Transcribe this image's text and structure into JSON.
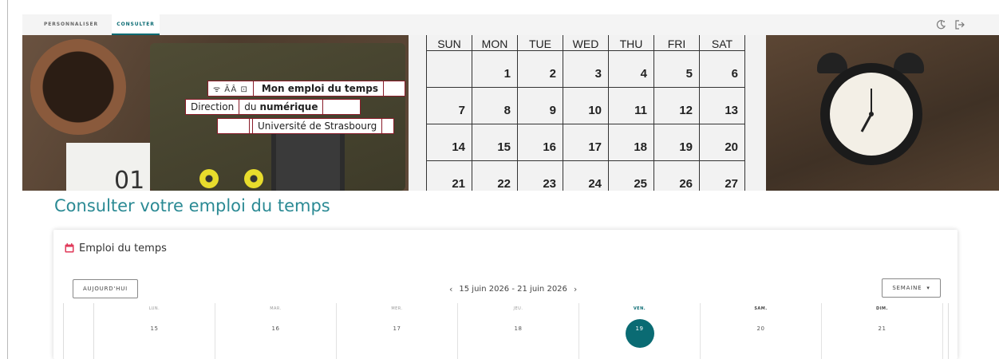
{
  "nav": {
    "tabs": [
      {
        "label": "PERSONNALISER",
        "active": false
      },
      {
        "label": "CONSULTER",
        "active": true
      }
    ],
    "icons": {
      "theme": "moon-sun-toggle-icon",
      "logout": "logout-icon"
    }
  },
  "banner": {
    "logo": {
      "symbols": "ᯤ ĂÂ ⊡",
      "line1": "Mon emploi du temps",
      "line2_prefix": "Direction",
      "line2_du": "du",
      "line2_bold": "numérique",
      "line3": "Université de Strasbourg"
    },
    "calendar_photo": {
      "weekdays": [
        "SUN",
        "MON",
        "TUE",
        "WED",
        "THU",
        "FRI",
        "SAT"
      ],
      "rows": [
        [
          "",
          "1",
          "2",
          "3",
          "4",
          "5",
          "6"
        ],
        [
          "7",
          "8",
          "9",
          "10",
          "11",
          "12",
          "13"
        ],
        [
          "14",
          "15",
          "16",
          "17",
          "18",
          "19",
          "20"
        ],
        [
          "21",
          "22",
          "23",
          "24",
          "25",
          "26",
          "27"
        ]
      ]
    },
    "paper_text": "01"
  },
  "page": {
    "title": "Consulter votre emploi du temps"
  },
  "schedule": {
    "card_title": "Emploi du temps",
    "today_button": "AUJOURD'HUI",
    "range_label": "15 juin 2026 - 21 juin 2026",
    "prev": "‹",
    "next": "›",
    "view_button": "SEMAINE",
    "view_caret": "▾",
    "days": [
      {
        "name": "LUN.",
        "num": "15"
      },
      {
        "name": "MAR.",
        "num": "16"
      },
      {
        "name": "MER.",
        "num": "17"
      },
      {
        "name": "JEU.",
        "num": "18"
      },
      {
        "name": "VEN.",
        "num": "19"
      },
      {
        "name": "SAM.",
        "num": "20"
      },
      {
        "name": "DIM.",
        "num": "21"
      }
    ],
    "today_index": 4
  },
  "colors": {
    "accent": "#0a6b73",
    "title": "#2b8a94",
    "logo_border": "#8a1d2a",
    "today_event": "#e03a5a"
  }
}
